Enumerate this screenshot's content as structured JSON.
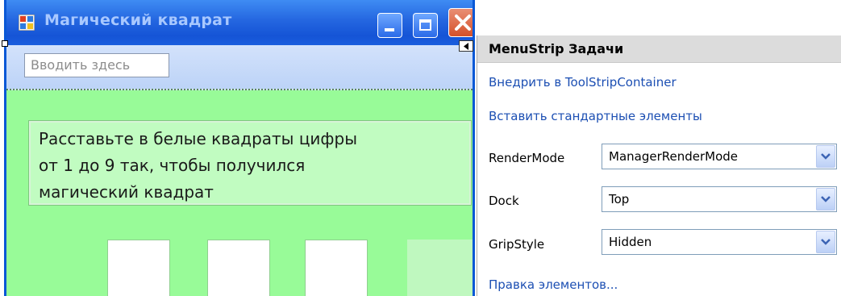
{
  "form": {
    "title": "Магический квадрат",
    "menu_strip": {
      "type_here_placeholder": "Вводить здесь"
    },
    "instruction_lines": [
      "Расставьте в белые квадраты цифры",
      "от 1 до 9 так, чтобы получился",
      "магический квадрат"
    ],
    "colors": {
      "form_background": "#98fb98",
      "title_bar": "#2466e0",
      "label_background": "#c1fcc1"
    }
  },
  "tasks_panel": {
    "title": "MenuStrip Задачи",
    "links": {
      "embed": "Внедрить в ToolStripContainer",
      "insert_standard": "Вставить стандартные элементы",
      "edit_items": "Правка элементов..."
    },
    "properties": [
      {
        "label": "RenderMode",
        "value": "ManagerRenderMode"
      },
      {
        "label": "Dock",
        "value": "Top"
      },
      {
        "label": "GripStyle",
        "value": "Hidden"
      }
    ],
    "colors": {
      "link": "#1c4fb3",
      "header_background": "#dcdcdc"
    }
  }
}
